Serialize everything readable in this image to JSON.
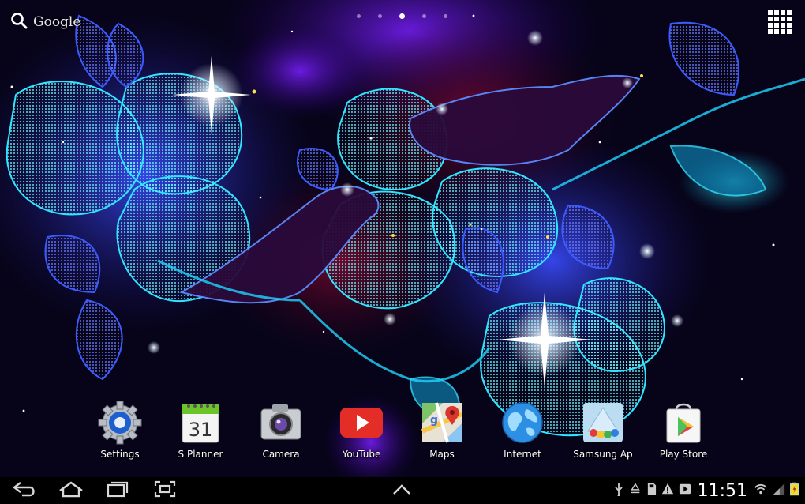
{
  "search": {
    "label": "Google"
  },
  "pages": {
    "count": 5,
    "active_index": 2
  },
  "dock": {
    "apps": [
      {
        "label": "Settings",
        "icon": "settings-icon"
      },
      {
        "label": "S Planner",
        "icon": "calendar-icon",
        "date": "31"
      },
      {
        "label": "Camera",
        "icon": "camera-icon"
      },
      {
        "label": "YouTube",
        "icon": "youtube-icon"
      },
      {
        "label": "Maps",
        "icon": "maps-icon"
      },
      {
        "label": "Internet",
        "icon": "globe-icon"
      },
      {
        "label": "Samsung Ap",
        "icon": "samsung-apps-icon"
      },
      {
        "label": "Play Store",
        "icon": "play-store-icon"
      }
    ]
  },
  "status_bar": {
    "time": "11:51"
  },
  "colors": {
    "navbar": "#000000",
    "accent": "#00e5ff",
    "youtube_red": "#e52d27"
  }
}
